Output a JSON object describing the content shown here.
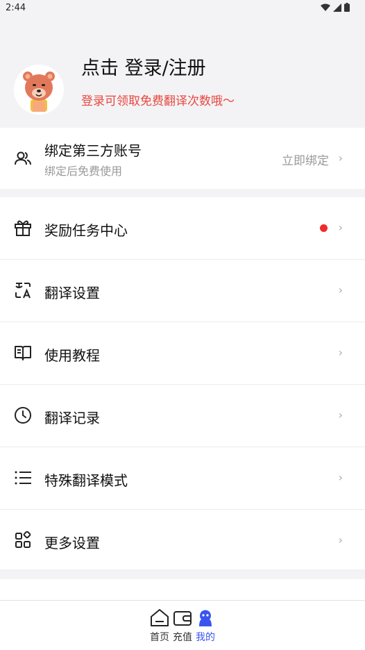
{
  "status_bar": {
    "time": "2:44"
  },
  "profile": {
    "login_title": "点击 登录/注册",
    "login_subtitle": "登录可领取免费翻译次数哦～"
  },
  "bind_account": {
    "title": "绑定第三方账号",
    "subtitle": "绑定后免费使用",
    "action": "立即绑定"
  },
  "menu": {
    "items": [
      {
        "label": "奖励任务中心",
        "icon": "gift-icon",
        "has_badge": true
      },
      {
        "label": "翻译设置",
        "icon": "translate-icon"
      },
      {
        "label": "使用教程",
        "icon": "book-icon"
      },
      {
        "label": "翻译记录",
        "icon": "clock-icon"
      },
      {
        "label": "特殊翻译模式",
        "icon": "list-icon"
      },
      {
        "label": "更多设置",
        "icon": "grid-icon"
      }
    ]
  },
  "tabbar": {
    "tabs": [
      {
        "label": "首页",
        "icon": "home-icon"
      },
      {
        "label": "充值",
        "icon": "wallet-icon"
      },
      {
        "label": "我的",
        "icon": "user-icon",
        "active": true
      }
    ]
  },
  "colors": {
    "accent": "#3a55ef",
    "login_hint": "#e8473f",
    "badge": "#f22a2a"
  }
}
